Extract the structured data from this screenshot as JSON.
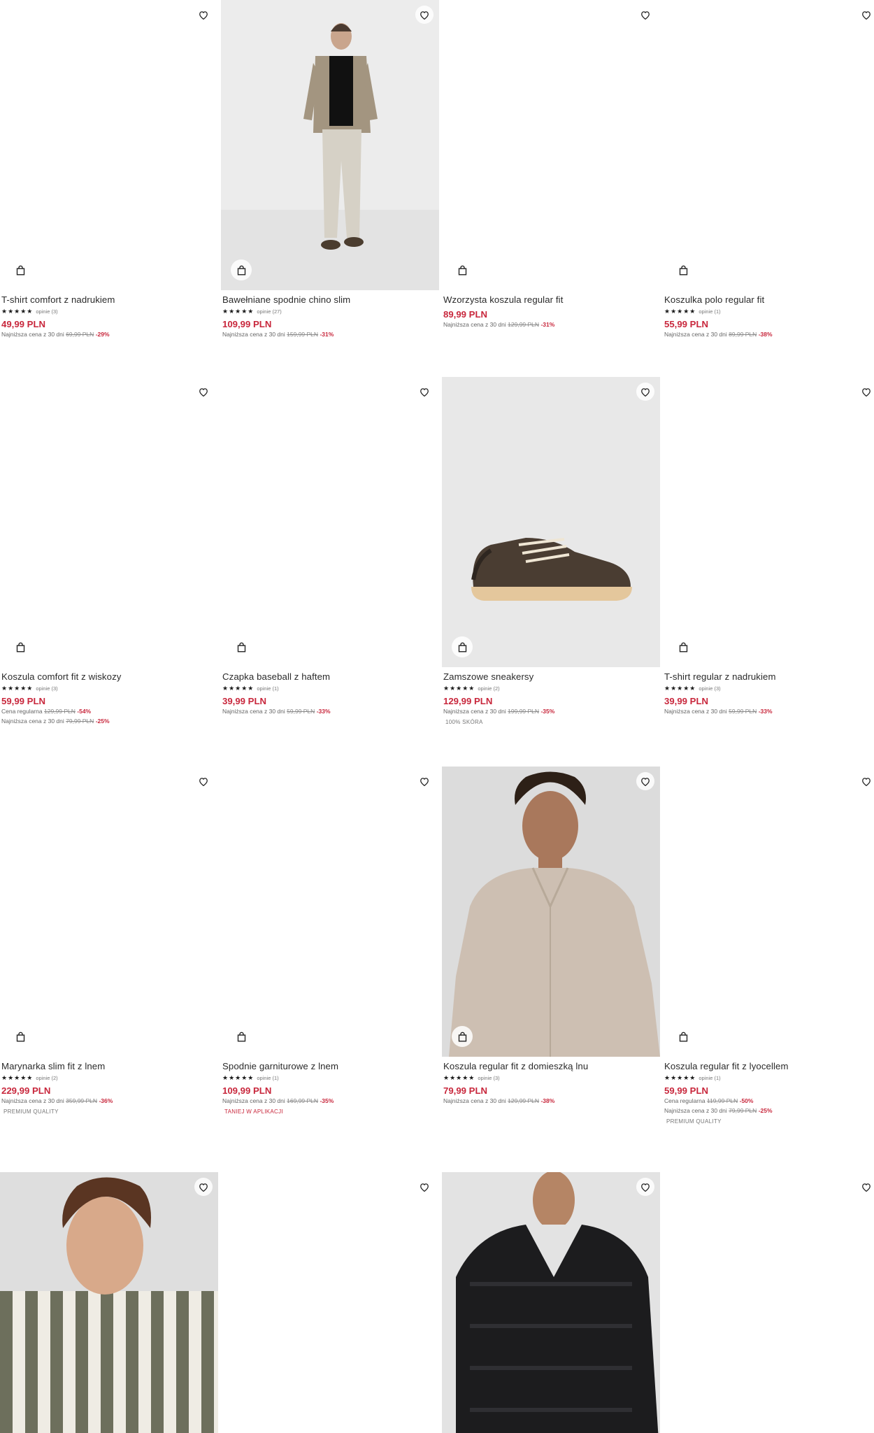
{
  "products": [
    {
      "name": "T-shirt comfort z nadrukiem",
      "reviews": "opinie (3)",
      "price": "49,99 PLN",
      "lines": [
        {
          "label": "Najniższa cena z 30 dni",
          "old": "69,99 PLN",
          "pct": "-29%"
        }
      ],
      "tag": ""
    },
    {
      "name": "Bawełniane spodnie chino slim",
      "reviews": "opinie (27)",
      "price": "109,99 PLN",
      "lines": [
        {
          "label": "Najniższa cena z 30 dni",
          "old": "159,99 PLN",
          "pct": "-31%"
        }
      ],
      "tag": ""
    },
    {
      "name": "Wzorzysta koszula regular fit",
      "reviews": "",
      "price": "89,99 PLN",
      "lines": [
        {
          "label": "Najniższa cena z 30 dni",
          "old": "129,99 PLN",
          "pct": "-31%"
        }
      ],
      "tag": ""
    },
    {
      "name": "Koszulka polo regular fit",
      "reviews": "opinie (1)",
      "price": "55,99 PLN",
      "lines": [
        {
          "label": "Najniższa cena z 30 dni",
          "old": "89,99 PLN",
          "pct": "-38%"
        }
      ],
      "tag": ""
    },
    {
      "name": "Koszula comfort fit z wiskozy",
      "reviews": "opinie (3)",
      "price": "59,99 PLN",
      "lines": [
        {
          "label": "Cena regularna",
          "old": "129,99 PLN",
          "pct": "-54%"
        },
        {
          "label": "Najniższa cena z 30 dni",
          "old": "79,99 PLN",
          "pct": "-25%"
        }
      ],
      "tag": ""
    },
    {
      "name": "Czapka baseball z haftem",
      "reviews": "opinie (1)",
      "price": "39,99 PLN",
      "lines": [
        {
          "label": "Najniższa cena z 30 dni",
          "old": "59,99 PLN",
          "pct": "-33%"
        }
      ],
      "tag": ""
    },
    {
      "name": "Zamszowe sneakersy",
      "reviews": "opinie (2)",
      "price": "129,99 PLN",
      "lines": [
        {
          "label": "Najniższa cena z 30 dni",
          "old": "199,99 PLN",
          "pct": "-35%"
        }
      ],
      "tag": "100% SKÓRA"
    },
    {
      "name": "T-shirt regular z nadrukiem",
      "reviews": "opinie (3)",
      "price": "39,99 PLN",
      "lines": [
        {
          "label": "Najniższa cena z 30 dni",
          "old": "59,99 PLN",
          "pct": "-33%"
        }
      ],
      "tag": ""
    },
    {
      "name": "Marynarka slim fit z lnem",
      "reviews": "opinie (2)",
      "price": "229,99 PLN",
      "lines": [
        {
          "label": "Najniższa cena z 30 dni",
          "old": "359,99 PLN",
          "pct": "-36%"
        }
      ],
      "tag": "PREMIUM QUALITY"
    },
    {
      "name": "Spodnie garniturowe z lnem",
      "reviews": "opinie (1)",
      "price": "109,99 PLN",
      "lines": [
        {
          "label": "Najniższa cena z 30 dni",
          "old": "169,99 PLN",
          "pct": "-35%"
        }
      ],
      "tag": "TANIEJ W APLIKACJI"
    },
    {
      "name": "Koszula regular fit z domieszką lnu",
      "reviews": "opinie (3)",
      "price": "79,99 PLN",
      "lines": [
        {
          "label": "Najniższa cena z 30 dni",
          "old": "129,99 PLN",
          "pct": "-38%"
        }
      ],
      "tag": ""
    },
    {
      "name": "Koszula regular fit z lyocellem",
      "reviews": "opinie (1)",
      "price": "59,99 PLN",
      "lines": [
        {
          "label": "Cena regularna",
          "old": "119,99 PLN",
          "pct": "-50%"
        },
        {
          "label": "Najniższa cena z 30 dni",
          "old": "79,99 PLN",
          "pct": "-25%"
        }
      ],
      "tag": "PREMIUM QUALITY"
    },
    {
      "name": "",
      "reviews": "",
      "price": "",
      "lines": [],
      "tag": ""
    },
    {
      "name": "",
      "reviews": "",
      "price": "",
      "lines": [],
      "tag": ""
    },
    {
      "name": "",
      "reviews": "",
      "price": "",
      "lines": [],
      "tag": ""
    },
    {
      "name": "",
      "reviews": "",
      "price": "",
      "lines": [],
      "tag": ""
    }
  ],
  "stars": "★★★★★",
  "icons": {
    "favorite": "heart-icon",
    "cart": "shopping-bag-icon"
  },
  "colors": {
    "price": "#c8273c",
    "discount": "#c8273c",
    "text": "#2a2a2a"
  }
}
